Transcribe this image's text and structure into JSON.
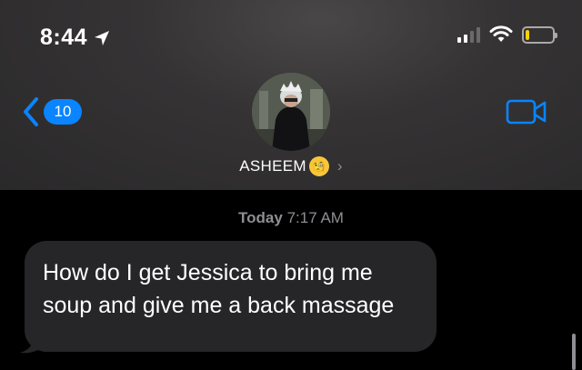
{
  "status_bar": {
    "time": "8:44",
    "location_icon": "location-arrow-icon",
    "signal_icon": "cellular-signal-icon",
    "wifi_icon": "wifi-icon",
    "battery_icon": "battery-icon",
    "battery_level": 0.15,
    "battery_color": "#f5d300"
  },
  "nav": {
    "back_icon": "chevron-left-icon",
    "unread_count": "10",
    "video_icon": "video-camera-icon",
    "accent_color": "#0a84ff"
  },
  "contact": {
    "name": "ASHEEM",
    "emoji": "🧐",
    "chevron_icon": "chevron-right-icon"
  },
  "conversation": {
    "timestamp_day": "Today",
    "timestamp_time": "7:17 AM",
    "messages": [
      {
        "direction": "incoming",
        "text": "How do I get Jessica to bring me soup and give me a back massage"
      }
    ]
  }
}
